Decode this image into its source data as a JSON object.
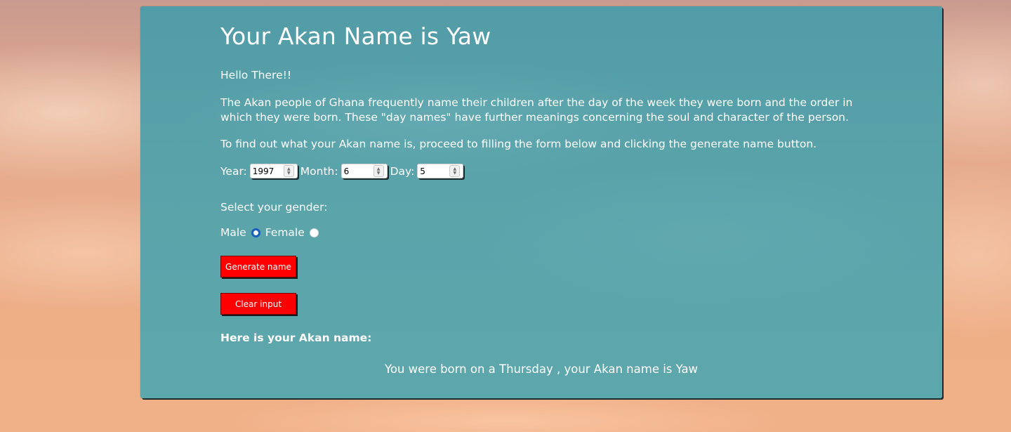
{
  "page": {
    "title": "Your Akan Name is Yaw"
  },
  "intro": {
    "greeting": "Hello There!!",
    "description": "The Akan people of Ghana frequently name their children after the day of the week they were born and the order in which they were born. These \"day names\" have further meanings concerning the soul and character of the person.",
    "instructions": "To find out what your Akan name is, proceed to filling the form below and clicking the generate name button."
  },
  "form": {
    "year_label": "Year:",
    "year_value": "1997",
    "month_label": "Month:",
    "month_value": "6",
    "day_label": "Day:",
    "day_value": "5",
    "gender_prompt": "Select your gender:",
    "male_label": "Male",
    "male_selected": true,
    "female_label": "Female",
    "female_selected": false,
    "generate_button": "Generate name",
    "clear_button": "Clear input"
  },
  "result": {
    "heading": "Here is your Akan name:",
    "text": "You were born on a Thursday , your Akan name is Yaw"
  },
  "colors": {
    "card_background": "#569fa8",
    "button_background": "#ff0000",
    "radio_checked": "#1a5fbf",
    "text": "#ffffff"
  },
  "icons": {
    "spinner_up": "chevron-up-icon",
    "spinner_down": "chevron-down-icon"
  }
}
